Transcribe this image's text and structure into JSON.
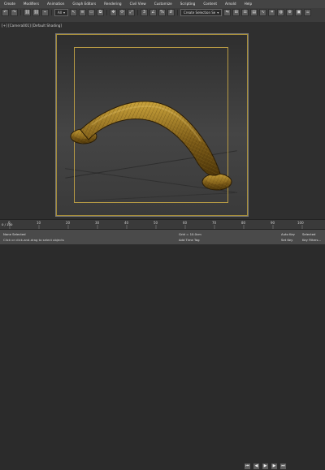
{
  "app": {
    "title": "3ds Max"
  },
  "menu": {
    "items": [
      "Create",
      "Modifiers",
      "Animation",
      "Graph Editors",
      "Rendering",
      "Civil View",
      "Customize",
      "Scripting",
      "Content",
      "Arnold",
      "Help"
    ]
  },
  "toolbar": {
    "selection_filter": "All",
    "selection_set": "Create Selection Se",
    "icons": [
      "undo-icon",
      "redo-icon",
      "link-icon",
      "unlink-icon",
      "bind-space-warp-icon",
      "select-icon",
      "select-by-name-icon",
      "rectangular-selection-icon",
      "window-crossing-icon",
      "move-icon",
      "rotate-icon",
      "scale-icon",
      "snaps-toggle-icon",
      "angle-snap-icon",
      "percent-snap-icon",
      "spinner-snap-icon",
      "mirror-icon",
      "align-icon",
      "layer-explorer-icon",
      "toggle-ribbon-icon",
      "curve-editor-icon",
      "schematic-view-icon",
      "material-editor-icon",
      "render-setup-icon",
      "rendered-frame-window-icon",
      "render-production-icon"
    ]
  },
  "viewport": {
    "label": "[+] [Camera001] [Default Shading]",
    "object_name": "cabinet-handle"
  },
  "timeline": {
    "ticks": [
      0,
      10,
      20,
      30,
      40,
      50,
      60,
      70,
      80,
      90,
      100
    ],
    "current_frame": "0 / 100"
  },
  "status": {
    "left_text": "None Selected",
    "hint_text": "Click or click-and-drag to select objects",
    "grid_text": "Grid = 10.0cm",
    "add_time_tag": "Add Time Tag",
    "auto_key": "Auto Key",
    "set_key": "Set Key",
    "selected": "Selected",
    "key_filters": "Key Filters..."
  },
  "colors": {
    "accent": "#a88f3a",
    "handle_base": "#6a4d13",
    "handle_highlight": "#b9912a"
  }
}
